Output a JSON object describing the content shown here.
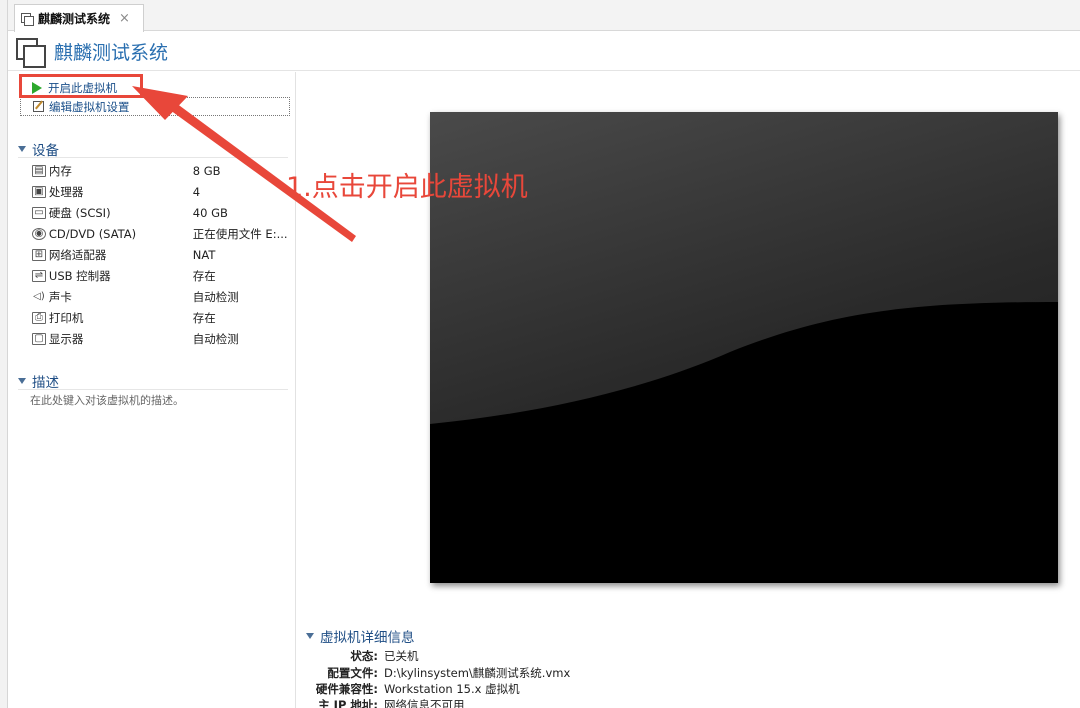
{
  "tab": {
    "label": "麒麟测试系统",
    "close": "×"
  },
  "header": {
    "title": "麒麟测试系统"
  },
  "actions": {
    "power_on": "开启此虚拟机",
    "edit_settings": "编辑虚拟机设置"
  },
  "devices": {
    "title": "设备",
    "items": [
      {
        "icon": "memory-icon",
        "name": "内存",
        "value": "8 GB"
      },
      {
        "icon": "processor-icon",
        "name": "处理器",
        "value": "4"
      },
      {
        "icon": "hard-disk-icon",
        "name": "硬盘 (SCSI)",
        "value": "40 GB"
      },
      {
        "icon": "cd-dvd-icon",
        "name": "CD/DVD (SATA)",
        "value": "正在使用文件 E:..."
      },
      {
        "icon": "network-adapter-icon",
        "name": "网络适配器",
        "value": "NAT"
      },
      {
        "icon": "usb-icon",
        "name": "USB 控制器",
        "value": "存在"
      },
      {
        "icon": "sound-card-icon",
        "name": "声卡",
        "value": "自动检测"
      },
      {
        "icon": "printer-icon",
        "name": "打印机",
        "value": "存在"
      },
      {
        "icon": "display-icon",
        "name": "显示器",
        "value": "自动检测"
      }
    ]
  },
  "description": {
    "title": "描述",
    "placeholder": "在此处键入对该虚拟机的描述。"
  },
  "annotation": {
    "text": "1.点击开启此虚拟机",
    "color": "#e8473a"
  },
  "details": {
    "title": "虚拟机详细信息",
    "rows": [
      {
        "key": "状态:",
        "value": "已关机"
      },
      {
        "key": "配置文件:",
        "value": "D:\\kylinsystem\\麒麟测试系统.vmx"
      },
      {
        "key": "硬件兼容性:",
        "value": "Workstation 15.x 虚拟机"
      },
      {
        "key": "主 IP 地址:",
        "value": "网络信息不可用"
      }
    ]
  },
  "colors": {
    "title_blue": "#2a6fb0",
    "section_blue": "#1f4e85",
    "play_green": "#2da82d",
    "highlight_red": "#e8473a"
  }
}
